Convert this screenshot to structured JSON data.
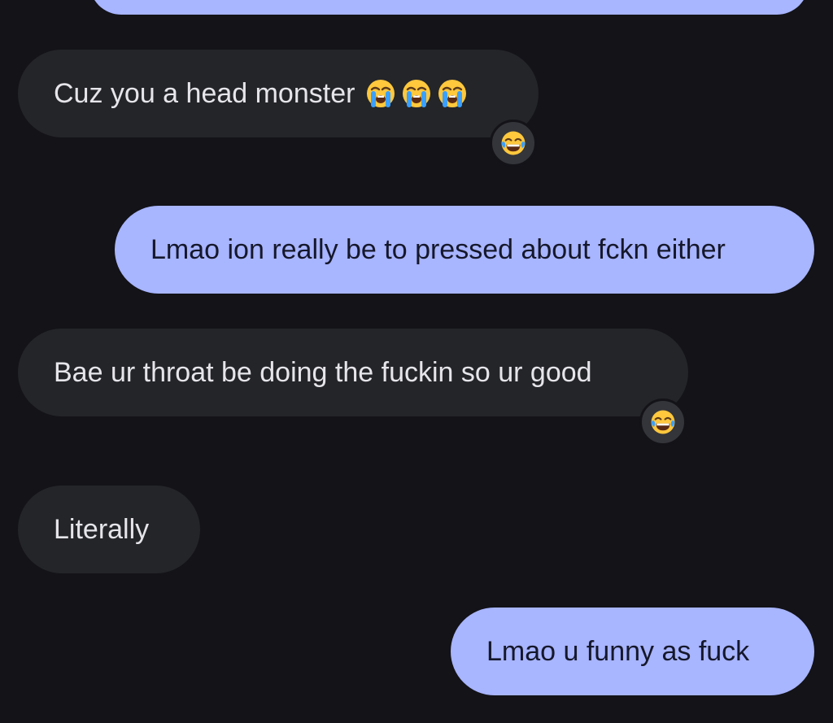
{
  "conversation": {
    "messages": [
      {
        "direction": "outgoing",
        "text": ""
      },
      {
        "direction": "incoming",
        "text": "Cuz you a head monster",
        "emoji": [
          "loudly-crying-face",
          "loudly-crying-face",
          "loudly-crying-face"
        ],
        "reaction": "face-with-tears-of-joy"
      },
      {
        "direction": "outgoing",
        "text": "Lmao ion really be to pressed about fckn either"
      },
      {
        "direction": "incoming",
        "text": "Bae ur throat be doing the fuckin so ur good",
        "reaction": "face-with-tears-of-joy"
      },
      {
        "direction": "incoming",
        "text": "Literally"
      },
      {
        "direction": "outgoing",
        "text": "Lmao u funny as fuck"
      }
    ]
  },
  "colors": {
    "background": "#131318",
    "incoming_bubble": "#242529",
    "outgoing_bubble": "#a8b5ff",
    "reaction_chip": "#34353a"
  }
}
